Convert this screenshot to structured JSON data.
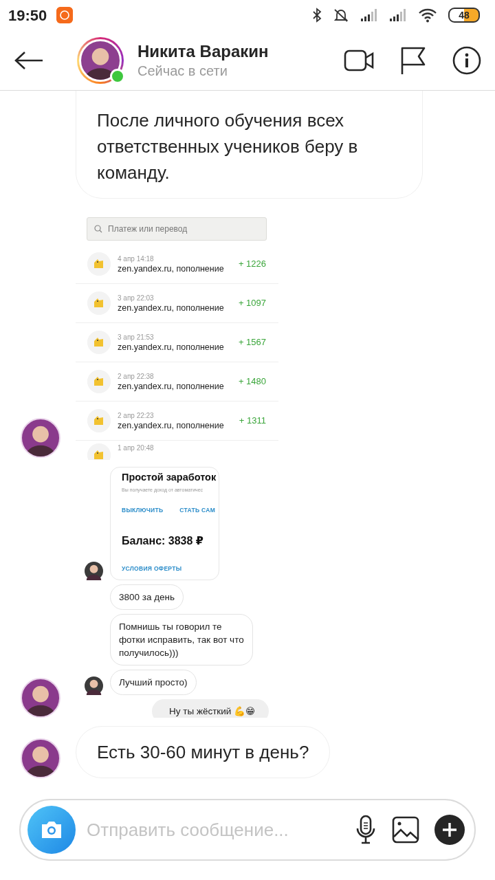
{
  "status_bar": {
    "time": "19:50",
    "battery": "48"
  },
  "header": {
    "name": "Никита Варакин",
    "status": "Сейчас в сети",
    "online": true
  },
  "messages": [
    {
      "kind": "text",
      "avatar": false,
      "text": "После личного обучения всех ответственных учеников беру в команду."
    },
    {
      "kind": "payments_screenshot",
      "avatar": true,
      "search_placeholder": "Платеж или перевод",
      "rows": [
        {
          "date": "4 апр 14:18",
          "title": "zen.yandex.ru, пополнение",
          "amount": "+ 1226"
        },
        {
          "date": "3 апр 22:03",
          "title": "zen.yandex.ru, пополнение",
          "amount": "+ 1097"
        },
        {
          "date": "3 апр 21:53",
          "title": "zen.yandex.ru, пополнение",
          "amount": "+ 1567"
        },
        {
          "date": "2 апр 22:38",
          "title": "zen.yandex.ru, пополнение",
          "amount": "+ 1480"
        },
        {
          "date": "2 апр 22:23",
          "title": "zen.yandex.ru, пополнение",
          "amount": "+ 1311"
        },
        {
          "date": "1 апр 20:48"
        }
      ]
    },
    {
      "kind": "chat_screenshot",
      "avatar": true,
      "items": [
        {
          "kind": "card",
          "avatar": true,
          "title": "Простой заработок",
          "subtitle": "Вы получаете доход от автоматичес",
          "actions": [
            "ВЫКЛЮЧИТЬ",
            "СТАТЬ САМ"
          ],
          "balance": "Баланс: 3838 ₽",
          "link": "УСЛОВИЯ ОФЕРТЫ"
        },
        {
          "kind": "text",
          "avatar": false,
          "text": "3800 за день"
        },
        {
          "kind": "text",
          "avatar": false,
          "text": "Помнишь ты говорил те фотки исправить, так вот что получилось)))"
        },
        {
          "kind": "text",
          "avatar": true,
          "text": "Лучший просто)"
        },
        {
          "kind": "own_text",
          "avatar": false,
          "text": "Ну ты жёсткий 💪😁"
        }
      ]
    },
    {
      "kind": "text",
      "avatar": true,
      "text": "Есть 30-60 минут в день?"
    }
  ],
  "composer": {
    "placeholder": "Отправить сообщение..."
  }
}
